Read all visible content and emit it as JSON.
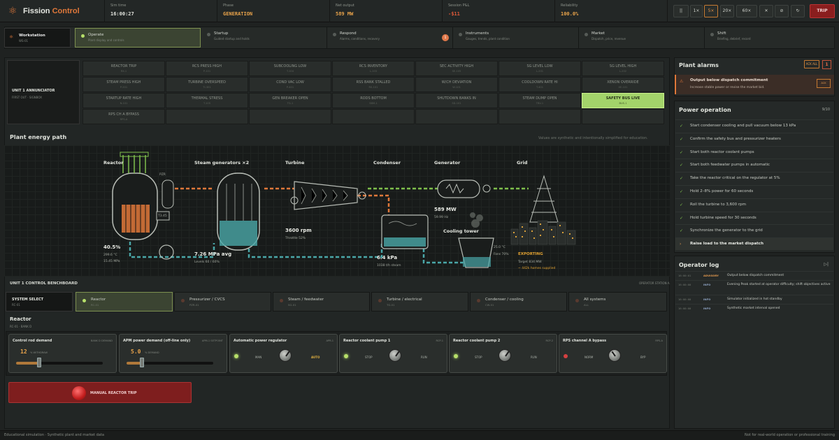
{
  "app": {
    "name_a": "Fission",
    "name_b": "Control",
    "logo_icon": "atom-icon"
  },
  "stats": [
    {
      "label": "Sim time",
      "value": "16:00:27"
    },
    {
      "label": "Phase",
      "value": "GENERATION"
    },
    {
      "label": "Net output",
      "value": "589 MW"
    },
    {
      "label": "Session P&L",
      "value": "-$11"
    },
    {
      "label": "Reliability",
      "value": "100.0%"
    }
  ],
  "speed": {
    "pause": "||",
    "s1": "1×",
    "s5": "5×",
    "s20": "20×",
    "s60": "60×",
    "mute": "✕",
    "hide": "⊘",
    "reset": "↻",
    "trip": "TRIP"
  },
  "workstation": {
    "title": "Workstation",
    "sub": "WS-01"
  },
  "tabs": [
    {
      "title": "Operate",
      "sub": "Plant display and controls"
    },
    {
      "title": "Startup",
      "sub": "Guided startup and holds"
    },
    {
      "title": "Respond",
      "sub": "Alarms, conditions, recovery",
      "badge": "1"
    },
    {
      "title": "Instruments",
      "sub": "Gauges, trends, plant condition"
    },
    {
      "title": "Market",
      "sub": "Dispatch, price, revenue"
    },
    {
      "title": "Shift",
      "sub": "Briefing, debrief, record"
    }
  ],
  "annunciator": {
    "title": "UNIT 1 ANNUNCIATOR",
    "sub": "FIRST OUT · SIGNBOX",
    "tiles": [
      {
        "a": "REACTOR TRIP",
        "b": "RX-1"
      },
      {
        "a": "RCS PRESS HIGH",
        "b": "P-101"
      },
      {
        "a": "SUBCOOLING LOW",
        "b": "T-104"
      },
      {
        "a": "RCS INVENTORY",
        "b": "L-103"
      },
      {
        "a": "SEC ACTIVITY HIGH",
        "b": "SE-105"
      },
      {
        "a": "SG LEVEL LOW",
        "b": "L-201"
      },
      {
        "a": "SG LEVEL HIGH",
        "b": "L-202"
      },
      {
        "a": "STEAM PRESS HIGH",
        "b": "P-201"
      },
      {
        "a": "TURBINE OVERSPEED",
        "b": "TI-301"
      },
      {
        "a": "COND VAC LOW",
        "b": "P-401"
      },
      {
        "a": "RSS BANK STALLED",
        "b": "RS-101"
      },
      {
        "a": "W/CH DEVIATION",
        "b": "W-101"
      },
      {
        "a": "COOLDOWN RATE HI",
        "b": "T-401"
      },
      {
        "a": "XENON OVERRIDE",
        "b": "XE-101"
      },
      {
        "a": "STARTUP RATE HIGH",
        "b": "N-101"
      },
      {
        "a": "THERMAL STRESS",
        "b": "T-105"
      },
      {
        "a": "GEN BREAKER OPEN",
        "b": "TG-1"
      },
      {
        "a": "RODS BOTTOM",
        "b": "SBM-1"
      },
      {
        "a": "SHUTDOWN BANKS IN",
        "b": "SD-101"
      },
      {
        "a": "STEAM DUMP OPEN",
        "b": "TBV-1"
      },
      {
        "a": "SAFETY BUS LIVE",
        "b": "BUS-1",
        "lit": true
      },
      {
        "a": "RPS CH A BYPASS",
        "b": "RPS-A"
      }
    ]
  },
  "energy": {
    "title": "Plant energy path",
    "note": "Values are synthetic and intentionally simplified for education.",
    "reactor": {
      "label": "Reactor",
      "power": "40.5%",
      "temp": "299.6 °C",
      "press": "15.45 MPa",
      "pzr": "PZR",
      "tavg": "T3.45"
    },
    "sg": {
      "label": "Steam generators ×2",
      "press": "7.26 MPa avg",
      "levels": "Levels 60 / 60%"
    },
    "turbine": {
      "label": "Turbine",
      "rpm": "3600 rpm",
      "throttle": "Throttle 52%"
    },
    "condenser": {
      "label": "Condenser",
      "vac": "6.4 kPa",
      "flow": "1038 t/h steam"
    },
    "generator": {
      "label": "Generator",
      "mw": "589 MW",
      "hz": "59.99 Hz"
    },
    "cooling": {
      "label": "Cooling tower",
      "temp": "25.0 °C",
      "fans": "Fans 70%"
    },
    "grid": {
      "label": "Grid",
      "exporting": "EXPORTING",
      "target": "Target 834 MW",
      "homes": "~ 442k homes supplied"
    }
  },
  "bench": {
    "title": "UNIT 1 CONTROL BENCHBOARD",
    "right": "OPERATOR STATION A",
    "syssel": {
      "t": "SYSTEM SELECT",
      "s": "RC-01"
    },
    "systems": [
      {
        "t": "Reactor",
        "s": "RC-01"
      },
      {
        "t": "Pressurizer / CVCS",
        "s": "PZR-01"
      },
      {
        "t": "Steam / feedwater",
        "s": "SG-01"
      },
      {
        "t": "Turbine / electrical",
        "s": "TG-01"
      },
      {
        "t": "Condenser / cooling",
        "s": "CW-01"
      },
      {
        "t": "All systems",
        "s": "ALL"
      }
    ],
    "reactor": {
      "title": "Reactor",
      "sub": "RC-01 · BANK D"
    },
    "controls": [
      {
        "t": "Control rod demand",
        "tag": "BANK D DEMAND",
        "value": "12",
        "unit": "% WITHDRAW",
        "level": 0.12
      },
      {
        "t": "APM power demand (off-line only)",
        "tag": "APM-1 SETPOINT",
        "value": "5.0",
        "unit": "% DEMAND",
        "level": 0.05
      },
      {
        "t": "Automatic power regulator",
        "tag": "APR-1",
        "l1": "MAN",
        "l2": "AUTO"
      },
      {
        "t": "Reactor coolant pump 1",
        "tag": "RCP-1",
        "l1": "STOP",
        "l2": "RUN"
      },
      {
        "t": "Reactor coolant pump 2",
        "tag": "RCP-2",
        "l1": "STOP",
        "l2": "RUN"
      },
      {
        "t": "RPS channel A bypass",
        "tag": "RPS-A",
        "l1": "NORM",
        "l2": "BYP"
      }
    ],
    "manual_trip": "MANUAL REACTOR TRIP"
  },
  "alarms": {
    "title": "Plant alarms",
    "ack_all": "ACK ALL",
    "count": "1",
    "items": [
      {
        "t": "Output below dispatch commitment",
        "s": "Increase stable power or revise the market bid.",
        "ack": "ACK"
      }
    ]
  },
  "power_op": {
    "title": "Power operation",
    "count": "9/10",
    "steps": [
      "Start condenser cooling and pull vacuum below 13 kPa",
      "Confirm the safety bus and pressurizer heaters",
      "Start both reactor coolant pumps",
      "Start both feedwater pumps in automatic",
      "Take the reactor critical on the regulator at 5%",
      "Hold 2–8% power for 60 seconds",
      "Roll the turbine to 3,600 rpm",
      "Hold turbine speed for 30 seconds",
      "Synchronize the generator to the grid",
      "Raise load to the market dispatch"
    ]
  },
  "oplog": {
    "title": "Operator log",
    "pause": "▷|",
    "rows": [
      {
        "tm": "16:00:01",
        "lv": "ADVISORY",
        "m": "Output below dispatch commitment"
      },
      {
        "tm": "16:00:00",
        "lv": "INFO",
        "m": "Evening Peak started at operator difficulty; shift objectives active"
      },
      {
        "tm": "16:00:00",
        "lv": "INFO",
        "m": "Simulator initialized in hot standby"
      },
      {
        "tm": "16:00:00",
        "lv": "INFO",
        "m": "Synthetic market interval opened"
      }
    ]
  },
  "footer": {
    "left": "Educational simulation · Synthetic plant and market data",
    "right": "Not for real-world operation or professional training"
  }
}
